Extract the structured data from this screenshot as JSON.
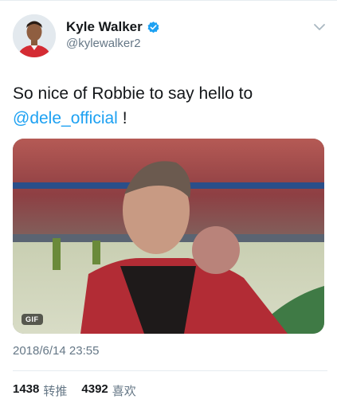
{
  "tweet": {
    "author": {
      "name": "Kyle Walker",
      "handle": "@kylewalker2",
      "verified": true
    },
    "text": "So nice of Robbie to say hello to",
    "mention": "@dele_official",
    "text_end": " !",
    "media": {
      "badge": "GIF"
    },
    "timestamp": "2018/6/14 23:55",
    "stats": {
      "retweets_count": "1438",
      "retweets_label": "转推",
      "likes_count": "4392",
      "likes_label": "喜欢"
    }
  },
  "colors": {
    "accent": "#1da1f2",
    "secondary_text": "#657786"
  }
}
